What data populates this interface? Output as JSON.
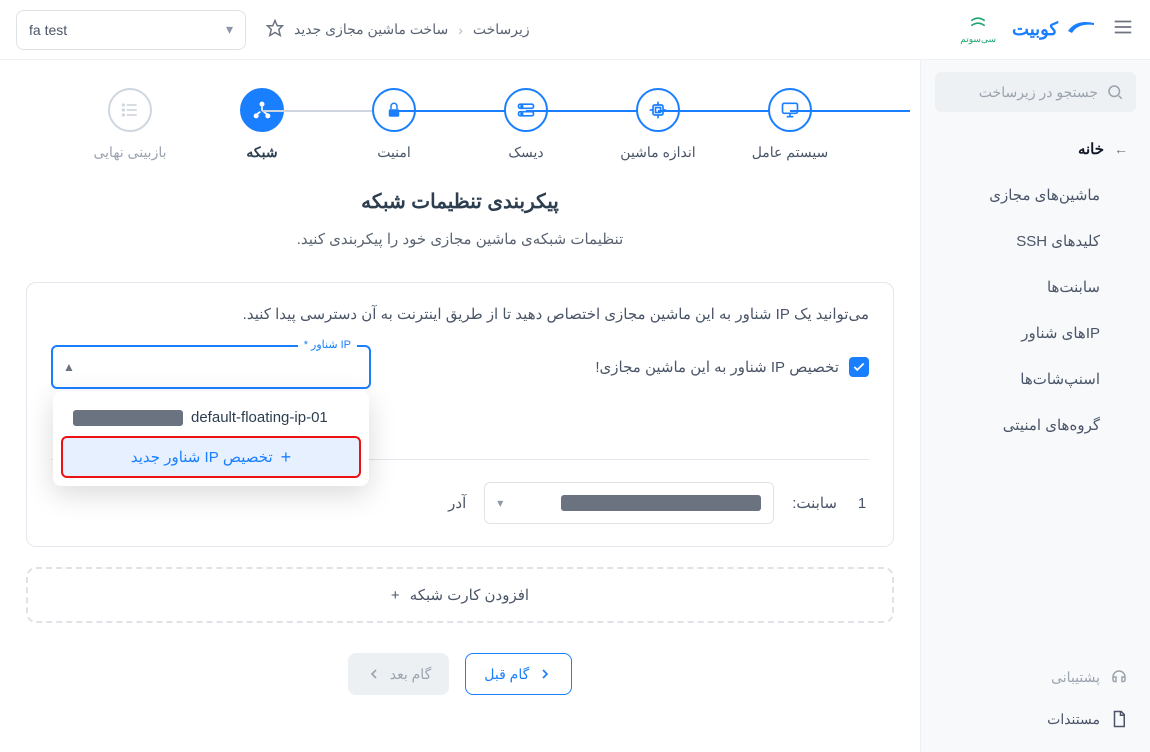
{
  "breadcrumb": {
    "root": "زیرساخت",
    "current": "ساخت ماشین مجازی جدید"
  },
  "project_selector": {
    "value": "fa test"
  },
  "brand": {
    "name": "کوبیت"
  },
  "search": {
    "placeholder": "جستجو در زیرساخت"
  },
  "sidebar": {
    "items": [
      {
        "label": "خانه"
      },
      {
        "label": "ماشین‌های مجازی"
      },
      {
        "label": "کلیدهای SSH"
      },
      {
        "label": "سابنت‌ها"
      },
      {
        "label": "IPهای شناور"
      },
      {
        "label": "اسنپ‌شات‌ها"
      },
      {
        "label": "گروه‌های امنیتی"
      }
    ],
    "support": "پشتیبانی",
    "docs": "مستندات"
  },
  "stepper": [
    {
      "label": "سیستم عامل",
      "icon": "monitor"
    },
    {
      "label": "اندازه ماشین",
      "icon": "cpu"
    },
    {
      "label": "دیسک",
      "icon": "disk"
    },
    {
      "label": "امنیت",
      "icon": "lock"
    },
    {
      "label": "شبکه",
      "icon": "network"
    },
    {
      "label": "بازبینی نهایی",
      "icon": "review"
    }
  ],
  "section": {
    "title": "پیکربندی تنظیمات شبکه",
    "subtitle": "تنظیمات شبکه‌ی ماشین مجازی خود را پیکربندی کنید."
  },
  "floating_ip": {
    "description": "می‌توانید یک IP شناور به این ماشین مجازی اختصاص دهید تا از طریق اینترنت به آن دسترسی پیدا کنید.",
    "checkbox_label": "تخصیص IP شناور به این ماشین مجازی!",
    "select_label": "IP شناور *",
    "options": {
      "existing": "default-floating-ip-01",
      "new": "تخصیص IP شناور جدید"
    }
  },
  "subnet": {
    "index": "1",
    "label": "سابنت:",
    "address_label": "آدر"
  },
  "add_nic": {
    "label": "افزودن کارت شبکه"
  },
  "buttons": {
    "prev": "گام قبل",
    "next": "گام بعد"
  }
}
